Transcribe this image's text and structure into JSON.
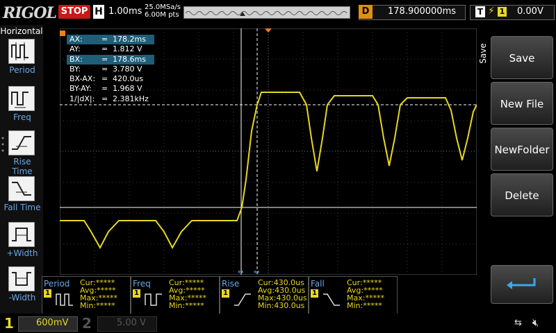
{
  "header": {
    "logo": "RIGOL",
    "run_state": "STOP",
    "timebase_label": "H",
    "timebase": "1.00ms",
    "sample_rate": "25.0MSa/s",
    "mem_depth": "6.00M pts",
    "delay_label": "D",
    "delay": "178.900000ms",
    "trigger_label": "T",
    "trigger_channel": "1",
    "trigger_level": "0.00V"
  },
  "left_menu": {
    "title": "Horizontal",
    "items": [
      {
        "label": "Period",
        "icon": "period-icon"
      },
      {
        "label": "Freq",
        "icon": "freq-icon"
      },
      {
        "label": "Rise Time",
        "icon": "rise-time-icon"
      },
      {
        "label": "Fall Time",
        "icon": "fall-time-icon"
      },
      {
        "label": "+Width",
        "icon": "pos-width-icon"
      },
      {
        "label": "-Width",
        "icon": "neg-width-icon"
      }
    ]
  },
  "right_menu": {
    "tab": "Save",
    "buttons": [
      "Save",
      "New File",
      "NewFolder",
      "Delete"
    ],
    "enter_icon": "enter-arrow-icon"
  },
  "cursor_readout": [
    {
      "key": "AX:",
      "value": "178.2ms",
      "highlight": true
    },
    {
      "key": "AY:",
      "value": "1.812 V",
      "highlight": false
    },
    {
      "key": "BX:",
      "value": "178.6ms",
      "highlight": true
    },
    {
      "key": "BY:",
      "value": "3.780 V",
      "highlight": false
    },
    {
      "key": "BX-AX:",
      "value": "420.0us",
      "highlight": false
    },
    {
      "key": "BY-AY:",
      "value": "1.968 V",
      "highlight": false
    },
    {
      "key": "1/|dX|:",
      "value": "2.381kHz",
      "highlight": false
    }
  ],
  "measurements": [
    {
      "name": "Period",
      "channel": "1",
      "cur": "Cur:*****",
      "avg": "Avg:*****",
      "max": "Max:*****",
      "min": "Min:*****"
    },
    {
      "name": "Freq",
      "channel": "1",
      "cur": "Cur:*****",
      "avg": "Avg:*****",
      "max": "Max:*****",
      "min": "Min:*****"
    },
    {
      "name": "Rise",
      "channel": "1",
      "cur": "Cur:430.0us",
      "avg": "Avg:430.0us",
      "max": "Max:430.0us",
      "min": "Min:430.0us"
    },
    {
      "name": "Fall",
      "channel": "1",
      "cur": "Cur:*****",
      "avg": "Avg:*****",
      "max": "Max:*****",
      "min": "Min:*****"
    }
  ],
  "channels": [
    {
      "num": "1",
      "scale": "600mV",
      "active": true
    },
    {
      "num": "2",
      "scale": "5.00 V",
      "active": false
    }
  ],
  "colors": {
    "ch1": "#e8d820",
    "cursor_highlight": "#1e5e78",
    "menu_label": "#6aa8e8",
    "stop": "#c81818"
  }
}
